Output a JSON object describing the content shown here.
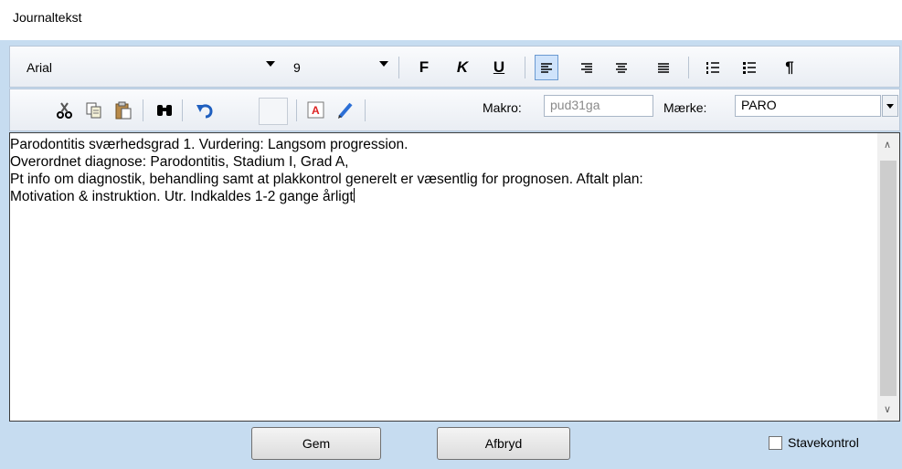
{
  "window": {
    "title": "Journaltekst"
  },
  "toolbar1": {
    "font": "Arial",
    "size": "9",
    "bold_label": "F",
    "italic_label": "K",
    "underline_label": "U",
    "paragraph_label": "¶"
  },
  "toolbar2": {
    "makro_label": "Makro:",
    "makro_value": "pud31ga",
    "maerke_label": "Mærke:",
    "maerke_value": "PARO"
  },
  "editor": {
    "line1": "Parodontitis sværhedsgrad 1. Vurdering: Langsom progression.",
    "line2": "Overordnet diagnose: Parodontitis, Stadium I, Grad A,",
    "line3": "Pt info om diagnostik, behandling samt at plakkontrol generelt er væsentlig for prognosen. Aftalt plan:",
    "line4": "Motivation & instruktion. Utr. Indkaldes 1-2 gange årligt"
  },
  "footer": {
    "save_label": "Gem",
    "cancel_label": "Afbryd",
    "spellcheck_label": "Stavekontrol",
    "spellcheck_checked": false
  },
  "colors": {
    "frame": "#c6dcf0",
    "active_button": "#cfe3fb"
  }
}
